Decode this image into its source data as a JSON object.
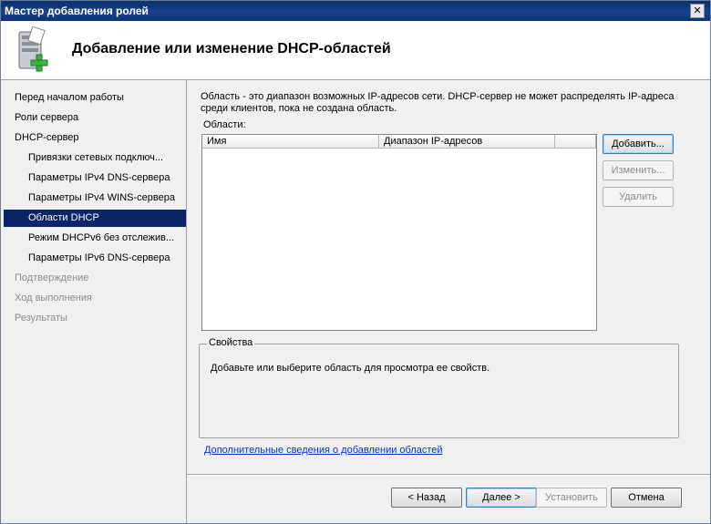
{
  "window": {
    "title": "Мастер добавления ролей",
    "close_glyph": "✕"
  },
  "header": {
    "title": "Добавление или изменение DHCP-областей",
    "icon": "server-add-icon"
  },
  "sidebar": {
    "items": [
      {
        "label": "Перед началом работы",
        "state": "normal"
      },
      {
        "label": "Роли сервера",
        "state": "normal"
      },
      {
        "label": "DHCP-сервер",
        "state": "normal"
      },
      {
        "label": "Привязки сетевых подключ...",
        "state": "normal"
      },
      {
        "label": "Параметры IPv4 DNS-сервера",
        "state": "normal"
      },
      {
        "label": "Параметры IPv4 WINS-сервера",
        "state": "normal"
      },
      {
        "label": "Области DHCP",
        "state": "selected"
      },
      {
        "label": "Режим DHCPv6 без отслежив...",
        "state": "normal"
      },
      {
        "label": "Параметры IPv6 DNS-сервера",
        "state": "normal"
      },
      {
        "label": "Подтверждение",
        "state": "disabled"
      },
      {
        "label": "Ход выполнения",
        "state": "disabled"
      },
      {
        "label": "Результаты",
        "state": "disabled"
      }
    ]
  },
  "main": {
    "description": "Область - это диапазон возможных IP-адресов сети. DHCP-сервер не может распределять IP-адреса среди клиентов, пока не создана область.",
    "areas_label": "Области:",
    "columns": [
      "Имя",
      "Диапазон IP-адресов"
    ],
    "buttons": {
      "add": "Добавить...",
      "edit": "Изменить...",
      "delete": "Удалить"
    },
    "properties": {
      "legend": "Свойства",
      "text": "Добавьте или выберите область для просмотра ее свойств."
    },
    "link": "Дополнительные сведения о добавлении областей"
  },
  "footer": {
    "back": "< Назад",
    "next": "Далее >",
    "install": "Установить",
    "cancel": "Отмена"
  }
}
